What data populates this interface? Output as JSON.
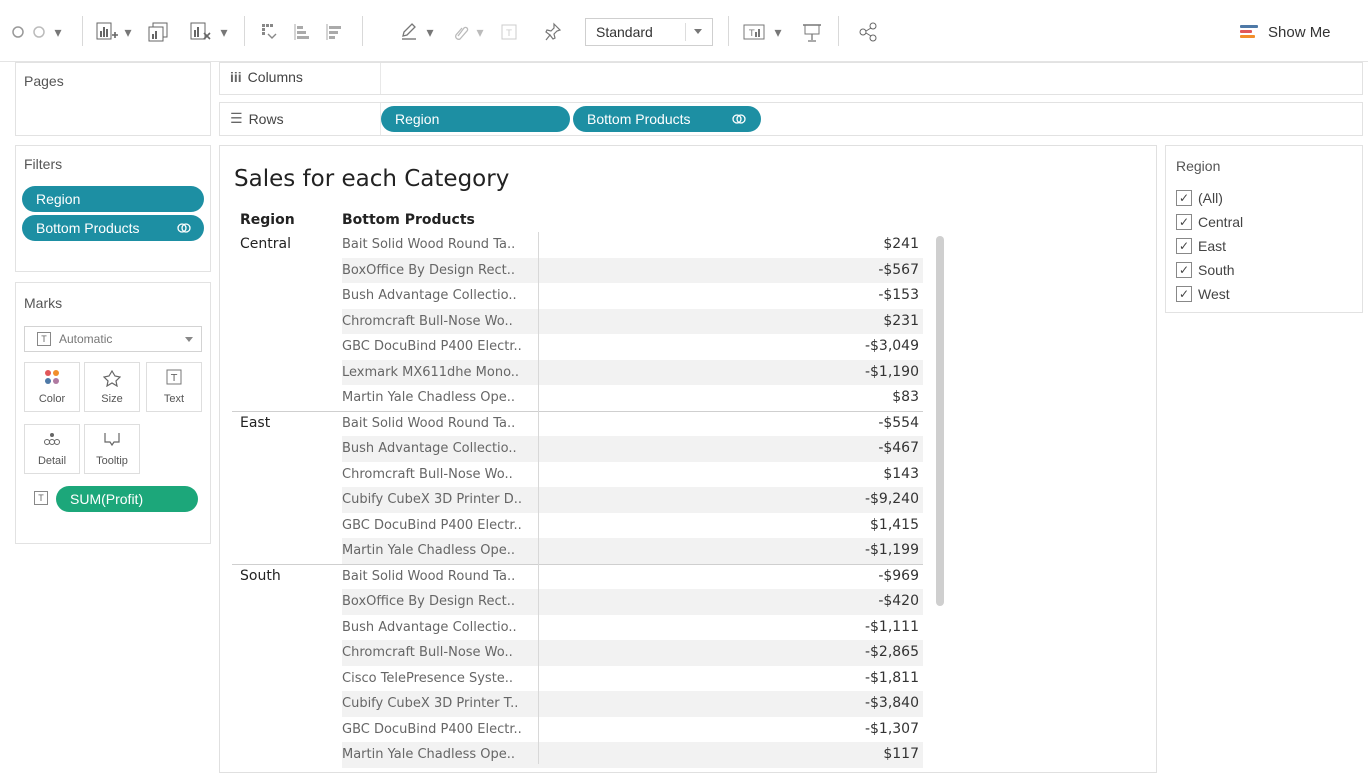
{
  "toolbar": {
    "mark_size": "Standard",
    "show_me": "Show Me"
  },
  "pages": {
    "title": "Pages"
  },
  "columns": {
    "label": "Columns"
  },
  "rows_shelf": {
    "label": "Rows",
    "pills": [
      "Region",
      "Bottom Products"
    ]
  },
  "filters": {
    "title": "Filters",
    "pills": [
      "Region",
      "Bottom Products"
    ]
  },
  "marks": {
    "title": "Marks",
    "type": "Automatic",
    "buttons": [
      "Color",
      "Size",
      "Text",
      "Detail",
      "Tooltip"
    ],
    "measure": "SUM(Profit)"
  },
  "sheet": {
    "title": "Sales for each Category",
    "headers": {
      "region": "Region",
      "product": "Bottom Products"
    },
    "regions": [
      {
        "name": "Central",
        "items": [
          {
            "product": "Bait Solid Wood Round Ta..",
            "value": "$241"
          },
          {
            "product": "BoxOffice By Design Rect..",
            "value": "-$567"
          },
          {
            "product": "Bush Advantage Collectio..",
            "value": "-$153"
          },
          {
            "product": "Chromcraft Bull-Nose Wo..",
            "value": "$231"
          },
          {
            "product": "GBC DocuBind P400 Electr..",
            "value": "-$3,049"
          },
          {
            "product": "Lexmark MX611dhe Mono..",
            "value": "-$1,190"
          },
          {
            "product": "Martin Yale Chadless Ope..",
            "value": "$83"
          }
        ]
      },
      {
        "name": "East",
        "items": [
          {
            "product": "Bait Solid Wood Round Ta..",
            "value": "-$554"
          },
          {
            "product": "Bush Advantage Collectio..",
            "value": "-$467"
          },
          {
            "product": "Chromcraft Bull-Nose Wo..",
            "value": "$143"
          },
          {
            "product": "Cubify CubeX 3D Printer D..",
            "value": "-$9,240"
          },
          {
            "product": "GBC DocuBind P400 Electr..",
            "value": "$1,415"
          },
          {
            "product": "Martin Yale Chadless Ope..",
            "value": "-$1,199"
          }
        ]
      },
      {
        "name": "South",
        "items": [
          {
            "product": "Bait Solid Wood Round Ta..",
            "value": "-$969"
          },
          {
            "product": "BoxOffice By Design Rect..",
            "value": "-$420"
          },
          {
            "product": "Bush Advantage Collectio..",
            "value": "-$1,111"
          },
          {
            "product": "Chromcraft Bull-Nose Wo..",
            "value": "-$2,865"
          },
          {
            "product": "Cisco TelePresence Syste..",
            "value": "-$1,811"
          },
          {
            "product": "Cubify CubeX 3D Printer T..",
            "value": "-$3,840"
          },
          {
            "product": "GBC DocuBind P400 Electr..",
            "value": "-$1,307"
          },
          {
            "product": "Martin Yale Chadless Ope..",
            "value": "$117"
          }
        ]
      }
    ]
  },
  "legend": {
    "title": "Region",
    "items": [
      "(All)",
      "Central",
      "East",
      "South",
      "West"
    ]
  },
  "colors": {
    "pill_teal": "#1d8fa3",
    "pill_green": "#1ca77a",
    "row_band": "#f2f2f2"
  },
  "icons": [
    "undo-icon",
    "new-worksheet-icon",
    "duplicate-sheet-icon",
    "clear-sheet-icon",
    "swap-icon",
    "sort-ascending-icon",
    "sort-descending-icon",
    "highlight-icon",
    "group-icon",
    "label-icon",
    "pin-icon",
    "show-cards-icon",
    "presentation-icon",
    "share-icon",
    "show-me-icon"
  ]
}
